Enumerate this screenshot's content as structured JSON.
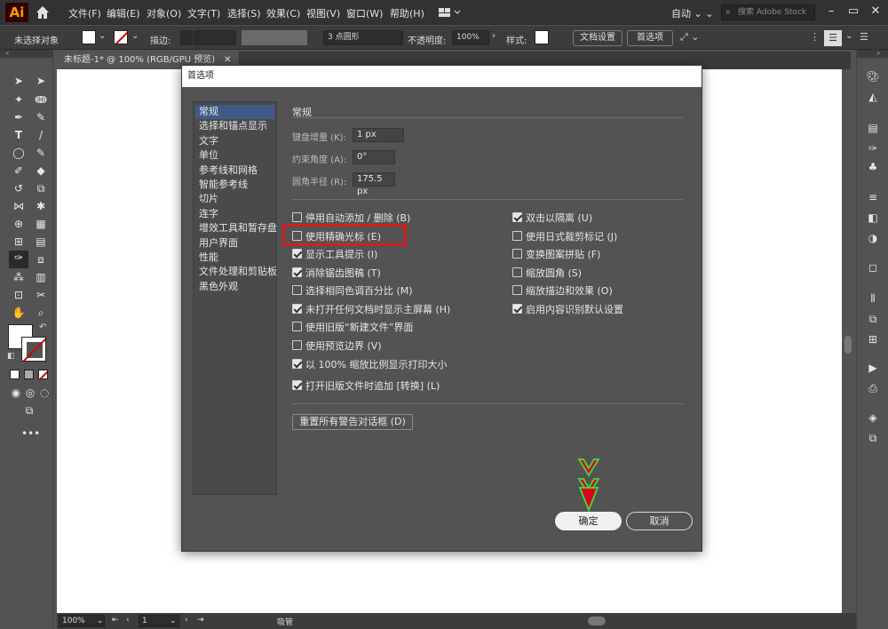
{
  "app": {
    "logo": "Ai"
  },
  "menubar": {
    "items": [
      "文件(F)",
      "编辑(E)",
      "对象(O)",
      "文字(T)",
      "选择(S)",
      "效果(C)",
      "视图(V)",
      "窗口(W)",
      "帮助(H)"
    ],
    "workspace": "自动",
    "search_placeholder": "搜索 Adobe Stock"
  },
  "controlbar": {
    "selection": "未选择对象",
    "stroke_label": "描边:",
    "brush": "3 点圆形",
    "opacity_label": "不透明度:",
    "opacity_value": "100%",
    "style_label": "样式:",
    "doc_setup": "文档设置",
    "preferences": "首选项"
  },
  "document": {
    "tab": "未标题-1* @ 100% (RGB/GPU 预览)"
  },
  "status": {
    "zoom": "100%",
    "artboard": "1",
    "tool": "吸管"
  },
  "dialog": {
    "title": "首选项",
    "categories": [
      "常规",
      "选择和锚点显示",
      "文字",
      "单位",
      "参考线和网格",
      "智能参考线",
      "切片",
      "连字",
      "增效工具和暂存盘",
      "用户界面",
      "性能",
      "文件处理和剪贴板",
      "黑色外观"
    ],
    "selected_category": "常规",
    "section": "常规",
    "fields": [
      {
        "label": "键盘增量 (K):",
        "value": "1 px"
      },
      {
        "label": "约束角度 (A):",
        "value": "0°"
      },
      {
        "label": "圆角半径 (R):",
        "value": "175.5 px"
      }
    ],
    "left_checks": [
      {
        "label": "停用自动添加 / 删除 (B)",
        "checked": false
      },
      {
        "label": "使用精确光标 (E)",
        "checked": false
      },
      {
        "label": "显示工具提示 (I)",
        "checked": true
      },
      {
        "label": "消除锯齿图稿 (T)",
        "checked": true
      },
      {
        "label": "选择相同色调百分比 (M)",
        "checked": false
      },
      {
        "label": "未打开任何文档时显示主屏幕 (H)",
        "checked": true
      },
      {
        "label": "使用旧版“新建文件”界面",
        "checked": false
      },
      {
        "label": "使用预览边界 (V)",
        "checked": false
      },
      {
        "label": "以 100% 缩放比例显示打印大小",
        "checked": true
      },
      {
        "label": "打开旧版文件时追加 [转换] (L)",
        "checked": true
      }
    ],
    "right_checks": [
      {
        "label": "双击以隔离 (U)",
        "checked": true
      },
      {
        "label": "使用日式裁剪标记 (J)",
        "checked": false
      },
      {
        "label": "变换图案拼贴 (F)",
        "checked": false
      },
      {
        "label": "缩放圆角 (S)",
        "checked": false
      },
      {
        "label": "缩放描边和效果 (O)",
        "checked": false
      },
      {
        "label": "启用内容识别默认设置",
        "checked": true
      }
    ],
    "reset_button": "重置所有警告对话框 (D)",
    "ok_button": "确定",
    "cancel_button": "取消"
  },
  "colors": {
    "highlight": "#d41e1e",
    "arrow": "#d8001c",
    "arrow_outline": "#4ec93a",
    "selected_category": "#3f5b85"
  }
}
